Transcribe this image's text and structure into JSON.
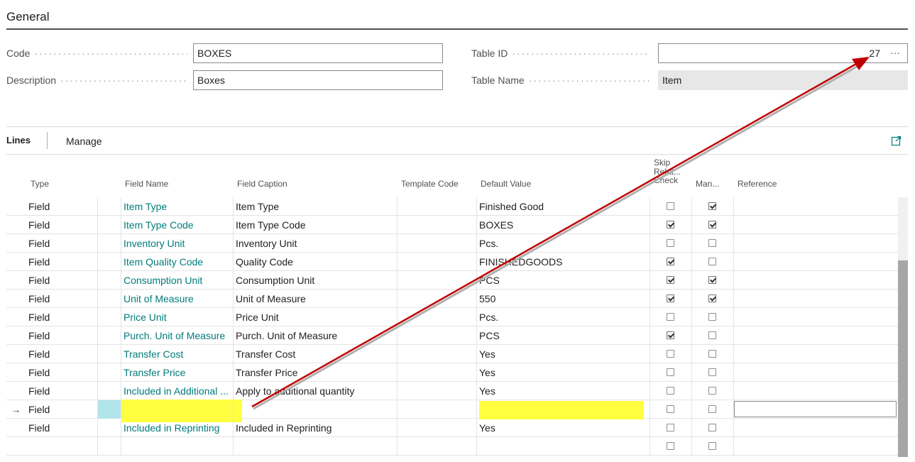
{
  "general": {
    "title": "General",
    "code_label": "Code",
    "code_value": "BOXES",
    "description_label": "Description",
    "description_value": "Boxes",
    "table_id_label": "Table ID",
    "table_id_value": "27",
    "table_id_lookup": "···",
    "table_name_label": "Table Name",
    "table_name_value": "Item"
  },
  "lines": {
    "tab_label": "Lines",
    "manage_label": "Manage",
    "expand_icon": "expand-icon",
    "columns": {
      "type": "Type",
      "field_name": "Field Name",
      "field_caption": "Field Caption",
      "template_code": "Template Code",
      "default_value": "Default Value",
      "skip_relation_1": "Skip",
      "skip_relation_2": "Relat...",
      "skip_relation_3": "Check",
      "mandatory": "Man...",
      "reference": "Reference"
    },
    "rows": [
      {
        "type": "Field",
        "field_name": "Item Type",
        "field_caption": "Item Type",
        "template_code": "",
        "default_value": "Finished Good",
        "skip": false,
        "mandatory": true
      },
      {
        "type": "Field",
        "field_name": "Item Type Code",
        "field_caption": "Item Type Code",
        "template_code": "",
        "default_value": "BOXES",
        "skip": true,
        "mandatory": true
      },
      {
        "type": "Field",
        "field_name": "Inventory Unit",
        "field_caption": "Inventory Unit",
        "template_code": "",
        "default_value": "Pcs.",
        "skip": false,
        "mandatory": false
      },
      {
        "type": "Field",
        "field_name": "Item Quality Code",
        "field_caption": "Quality Code",
        "template_code": "",
        "default_value": "FINISHEDGOODS",
        "skip": true,
        "mandatory": false
      },
      {
        "type": "Field",
        "field_name": "Consumption Unit",
        "field_caption": "Consumption Unit",
        "template_code": "",
        "default_value": "PCS",
        "skip": true,
        "mandatory": true
      },
      {
        "type": "Field",
        "field_name": "Unit of Measure",
        "field_caption": "Unit of Measure",
        "template_code": "",
        "default_value": "550",
        "skip": true,
        "mandatory": true
      },
      {
        "type": "Field",
        "field_name": "Price Unit",
        "field_caption": "Price Unit",
        "template_code": "",
        "default_value": "Pcs.",
        "skip": false,
        "mandatory": false
      },
      {
        "type": "Field",
        "field_name": "Purch. Unit of Measure",
        "field_caption": "Purch. Unit of Measure",
        "template_code": "",
        "default_value": "PCS",
        "skip": true,
        "mandatory": false
      },
      {
        "type": "Field",
        "field_name": "Transfer Cost",
        "field_caption": "Transfer Cost",
        "template_code": "",
        "default_value": "Yes",
        "skip": false,
        "mandatory": false
      },
      {
        "type": "Field",
        "field_name": "Transfer Price",
        "field_caption": "Transfer Price",
        "template_code": "",
        "default_value": "Yes",
        "skip": false,
        "mandatory": false
      },
      {
        "type": "Field",
        "field_name": "Included in Additional ...",
        "field_caption": "Apply to additional quantity",
        "template_code": "",
        "default_value": "Yes",
        "skip": false,
        "mandatory": false
      },
      {
        "type": "Field",
        "field_name": "",
        "field_caption": "",
        "template_code": "",
        "default_value": "",
        "skip": false,
        "mandatory": false,
        "selected": true,
        "marker": "→"
      },
      {
        "type": "Field",
        "field_name": "Included in Reprinting",
        "field_caption": "Included in Reprinting",
        "template_code": "",
        "default_value": "Yes",
        "skip": false,
        "mandatory": false
      },
      {
        "type": "",
        "field_name": "",
        "field_caption": "",
        "template_code": "",
        "default_value": "",
        "skip": false,
        "mandatory": false
      }
    ]
  },
  "colors": {
    "link": "#007b7b",
    "highlight_yellow": "#ffff40",
    "highlight_cyan": "#b2e5ea",
    "annotation_arrow": "#c00000"
  }
}
